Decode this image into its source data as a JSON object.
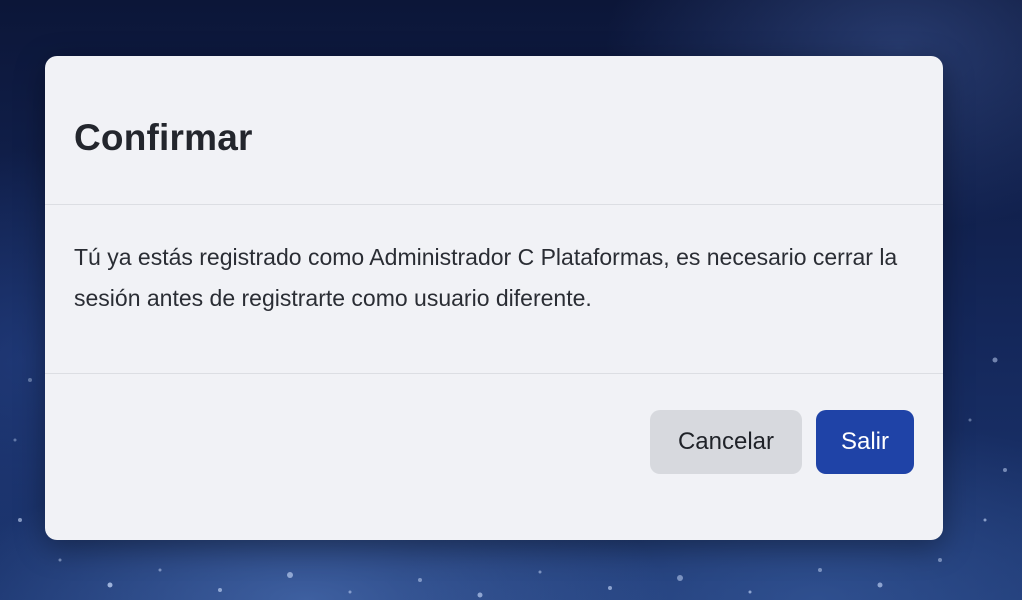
{
  "dialog": {
    "title": "Confirmar",
    "message": "Tú ya estás registrado como Administrador C Plataformas, es necesario cerrar la sesión antes de registrarte como usuario diferente.",
    "cancel_label": "Cancelar",
    "confirm_label": "Salir"
  },
  "colors": {
    "primary_button": "#1f43a7",
    "secondary_button": "#d7d9de",
    "dialog_background": "#f1f2f6",
    "page_background": "#0f1c44"
  }
}
